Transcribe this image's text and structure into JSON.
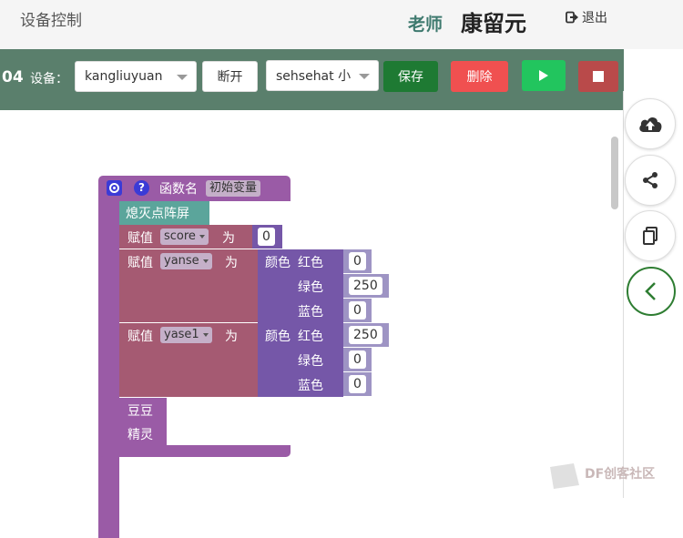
{
  "header": {
    "title": "设备控制",
    "teacher_label": "老师",
    "teacher_name": "康留元",
    "logout_label": "退出"
  },
  "toolbar": {
    "number": "04",
    "device_label": "设备：",
    "device_value": "kangliuyuan",
    "disconnect_label": "断开",
    "project_value": "sehsehat 小",
    "save_label": "保存",
    "delete_label": "删除"
  },
  "colors": {
    "toolbar_bg": "#5a7f6c",
    "save": "#1e7a33",
    "delete": "#f05050",
    "run": "#22c55e",
    "stop": "#b94a4a",
    "function_block": "#9a5ba6",
    "variable_block": "#a55a72",
    "color_block": "#7557a8",
    "led_block": "#5ba59b"
  },
  "right_tools": [
    "cloud-upload-icon",
    "share-icon",
    "copy-icon",
    "collapse-icon"
  ],
  "blocks": {
    "function": {
      "label": "函数名",
      "name": "初始变量"
    },
    "led_clear": "熄灭点阵屏",
    "assign_label": "赋值",
    "as_label": "为",
    "assign1": {
      "var": "score",
      "value": "0"
    },
    "assign2": {
      "var": "yanse",
      "color_label": "颜色",
      "red_label": "红色",
      "green_label": "绿色",
      "blue_label": "蓝色",
      "red": "0",
      "green": "250",
      "blue": "0"
    },
    "assign3": {
      "var": "yase1",
      "color_label": "颜色",
      "red_label": "红色",
      "green_label": "绿色",
      "blue_label": "蓝色",
      "red": "250",
      "green": "0",
      "blue": "0"
    },
    "call1": "豆豆",
    "call2": "精灵"
  },
  "watermark": {
    "text": "DF创客社区"
  }
}
